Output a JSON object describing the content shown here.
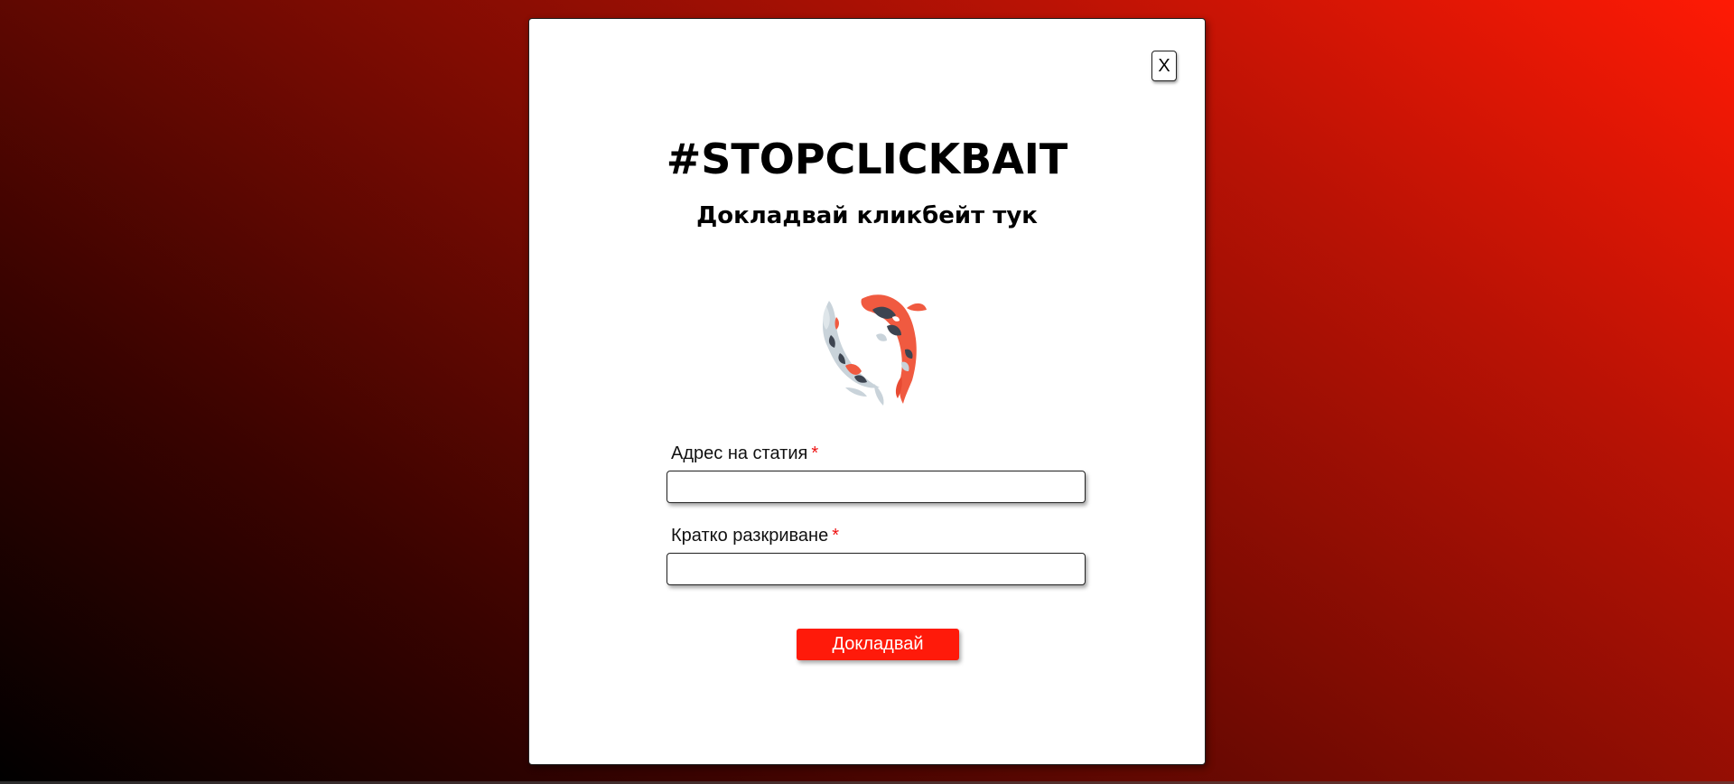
{
  "modal": {
    "close_label": "X",
    "title": "#STOPCLICKBAIT",
    "subtitle": "Докладвай кликбейт тук",
    "logo_icon": "koi-fish-icon",
    "fields": [
      {
        "label": "Адрес на статия",
        "required_mark": "*",
        "value": "",
        "placeholder": ""
      },
      {
        "label": "Кратко разкриване",
        "required_mark": "*",
        "value": "",
        "placeholder": ""
      }
    ],
    "submit_label": "Докладвай"
  },
  "colors": {
    "accent": "#ff1a0a",
    "required": "#ee1111",
    "koi_orange": "#f05a40",
    "koi_dark": "#3d4450",
    "koi_light": "#c9d3da"
  }
}
